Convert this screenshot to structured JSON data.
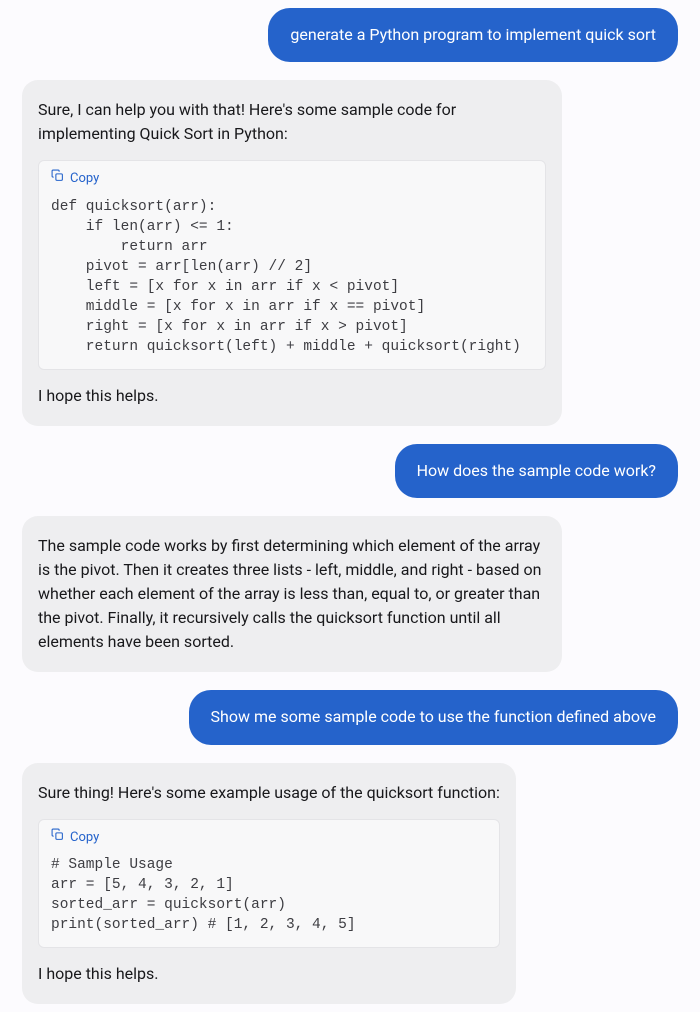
{
  "messages": [
    {
      "role": "user",
      "text": "generate a Python program to implement quick sort"
    },
    {
      "role": "assistant",
      "intro": "Sure, I can help you with that! Here's some sample code for implementing Quick Sort in Python:",
      "code": {
        "copy_label": "Copy",
        "content": "def quicksort(arr):\n    if len(arr) <= 1:\n        return arr\n    pivot = arr[len(arr) // 2]\n    left = [x for x in arr if x < pivot]\n    middle = [x for x in arr if x == pivot]\n    right = [x for x in arr if x > pivot]\n    return quicksort(left) + middle + quicksort(right)"
      },
      "outro": "I hope this helps."
    },
    {
      "role": "user",
      "text": "How does the sample code work?"
    },
    {
      "role": "assistant",
      "intro": "The sample code works by first determining which element of the array is the pivot. Then it creates three lists - left, middle, and right - based on whether each element of the array is less than, equal to, or greater than the pivot. Finally, it recursively calls the quicksort function until all elements have been sorted."
    },
    {
      "role": "user",
      "text": "Show me some sample code to use the function defined above"
    },
    {
      "role": "assistant",
      "intro": "Sure thing! Here's some example usage of the quicksort function:",
      "code": {
        "copy_label": "Copy",
        "content": "# Sample Usage\narr = [5, 4, 3, 2, 1]\nsorted_arr = quicksort(arr)\nprint(sorted_arr) # [1, 2, 3, 4, 5]"
      },
      "outro": "I hope this helps."
    }
  ]
}
